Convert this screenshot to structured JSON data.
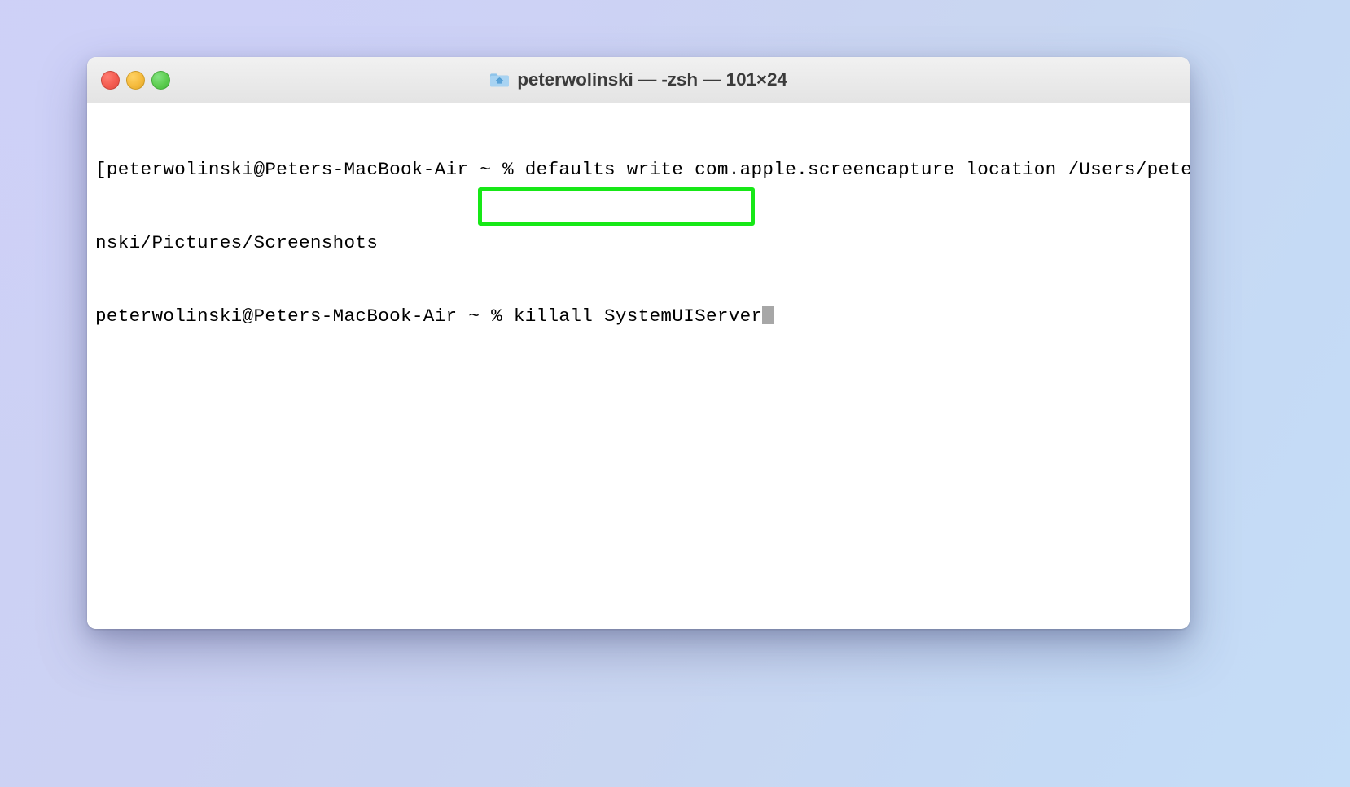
{
  "window": {
    "title": "peterwolinski — -zsh — 101×24",
    "icon": "folder-icon",
    "traffic_lights": [
      {
        "name": "close",
        "label": "Close",
        "color": "#f45d52"
      },
      {
        "name": "minimize",
        "label": "Minimize",
        "color": "#f6bc3f"
      },
      {
        "name": "zoom",
        "label": "Zoom",
        "color": "#5fce52"
      }
    ]
  },
  "terminal": {
    "lines": [
      "[peterwolinski@Peters-MacBook-Air ~ % defaults write com.apple.screencapture location /Users/peterwoli]",
      "nski/Pictures/Screenshots",
      "peterwolinski@Peters-MacBook-Air ~ % killall SystemUIServer"
    ],
    "prompt": "peterwolinski@Peters-MacBook-Air ~ %",
    "current_command": "killall SystemUIServer",
    "cursor": "block"
  },
  "annotation": {
    "highlight_text": "killall SystemUIServer",
    "color": "#17e817"
  },
  "desktop": {
    "background_start": "#ccd0f4",
    "background_end": "#c5ddf7"
  }
}
